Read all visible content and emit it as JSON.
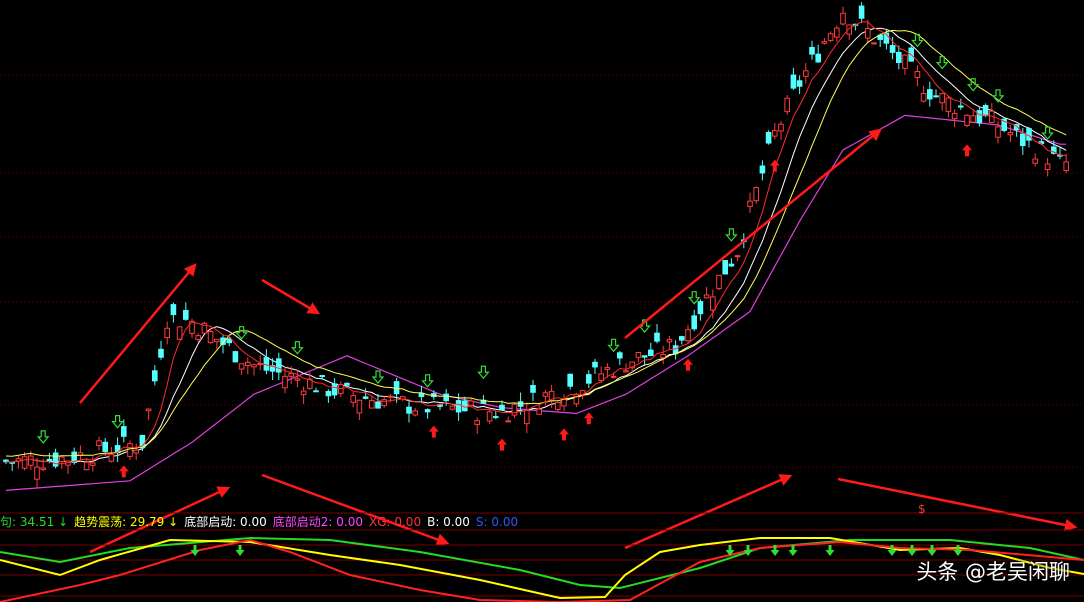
{
  "colors": {
    "background": "#000000",
    "up_candle": "#ff3b3b",
    "down_candle": "#54ffff",
    "ma_fast": "#ff2a2a",
    "ma_white": "#ffffff",
    "ma_yellow": "#ffff55",
    "ma_slow": "#e040e0",
    "grid": "#7a0000",
    "trend_arrow": "#ff1a1a",
    "buy_arrow": "#ff1a1a",
    "sell_arrow": "#33dd33",
    "ind_green": "#22dd22",
    "ind_yellow": "#ffff00",
    "ind_red": "#ff2222"
  },
  "legend": [
    {
      "label": "句: 34.51",
      "suffix": "↓",
      "color": "#22dd22"
    },
    {
      "label": "趋势震荡: 29.79",
      "suffix": "↓",
      "color": "#ffff00"
    },
    {
      "label": "底部启动: 0.00",
      "suffix": "",
      "color": "#ffffff"
    },
    {
      "label": "底部启动2: 0.00",
      "suffix": "",
      "color": "#ff44ff"
    },
    {
      "label": "XG: 0.00",
      "suffix": "",
      "color": "#ff3333"
    },
    {
      "label": "B: 0.00",
      "suffix": "",
      "color": "#ffffff"
    },
    {
      "label": "S: 0.00",
      "suffix": "",
      "color": "#3355ff"
    }
  ],
  "indicator_marker": "$",
  "watermark": "头条 @老吴闲聊",
  "chart_data": [
    {
      "type": "candlestick",
      "title": "",
      "series": [
        {
          "name": "",
          "segments": [
            [
              0,
              0.2
            ],
            [
              10,
              0.22
            ],
            [
              22,
              0.3
            ],
            [
              26,
              0.95
            ],
            [
              30,
              0.93
            ],
            [
              40,
              0.7
            ],
            [
              55,
              0.55
            ],
            [
              66,
              0.49
            ],
            [
              74,
              0.47
            ],
            [
              80,
              0.46
            ],
            [
              92,
              0.6
            ],
            [
              100,
              0.72
            ],
            [
              108,
              0.8
            ],
            [
              118,
              1.3
            ],
            [
              124,
              1.9
            ],
            [
              128,
              2.17
            ],
            [
              135,
              2.55
            ],
            [
              142,
              2.35
            ],
            [
              150,
              2.1
            ],
            [
              160,
              1.95
            ],
            [
              170,
              1.75
            ]
          ]
        },
        {
          "name": "",
          "segments": [
            [
              0,
              0.05
            ],
            [
              20,
              0.1
            ],
            [
              30,
              0.3
            ],
            [
              40,
              0.55
            ],
            [
              55,
              0.75
            ],
            [
              70,
              0.55
            ],
            [
              80,
              0.48
            ],
            [
              92,
              0.45
            ],
            [
              100,
              0.55
            ],
            [
              110,
              0.75
            ],
            [
              120,
              0.98
            ],
            [
              128,
              1.45
            ],
            [
              135,
              1.82
            ],
            [
              145,
              2.0
            ],
            [
              160,
              1.95
            ],
            [
              170,
              1.85
            ]
          ]
        }
      ],
      "buy_signals_idx": [
        19,
        69,
        80,
        90,
        94,
        110,
        124,
        155
      ],
      "sell_signals_idx": [
        6,
        18,
        38,
        47,
        60,
        68,
        77,
        98,
        103,
        111,
        117,
        137,
        147,
        151,
        156,
        160,
        168
      ]
    },
    {
      "type": "line",
      "title": "",
      "series": [
        {
          "name": "趋势震荡",
          "values_desc": "oscillator"
        },
        {
          "name": "句",
          "values_desc": "oscillator"
        }
      ]
    }
  ]
}
